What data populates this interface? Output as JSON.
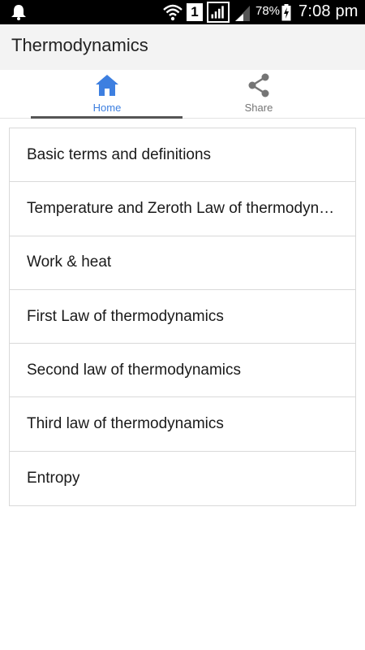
{
  "status_bar": {
    "sim_slot": "1",
    "battery_percent": "78%",
    "time": "7:08 pm",
    "icons": [
      "notification-bell-icon",
      "wifi-icon",
      "sim-icon",
      "cell-signal-icon",
      "cell-signal-2-icon",
      "battery-charging-icon"
    ]
  },
  "app_bar": {
    "title": "Thermodynamics"
  },
  "tabs": [
    {
      "label": "Home",
      "icon": "home-icon",
      "selected": true
    },
    {
      "label": "Share",
      "icon": "share-icon",
      "selected": false
    }
  ],
  "topics": [
    {
      "label": "Basic terms and definitions"
    },
    {
      "label": "Temperature and Zeroth Law of thermodynamics"
    },
    {
      "label": "Work & heat"
    },
    {
      "label": "First Law of thermodynamics"
    },
    {
      "label": "Second law of thermodynamics"
    },
    {
      "label": "Third law of thermodynamics"
    },
    {
      "label": "Entropy"
    }
  ],
  "colors": {
    "accent": "#3d7fe0",
    "status_bar": "#000000",
    "app_bar": "#f3f3f3",
    "inactive_tab": "#757575"
  }
}
